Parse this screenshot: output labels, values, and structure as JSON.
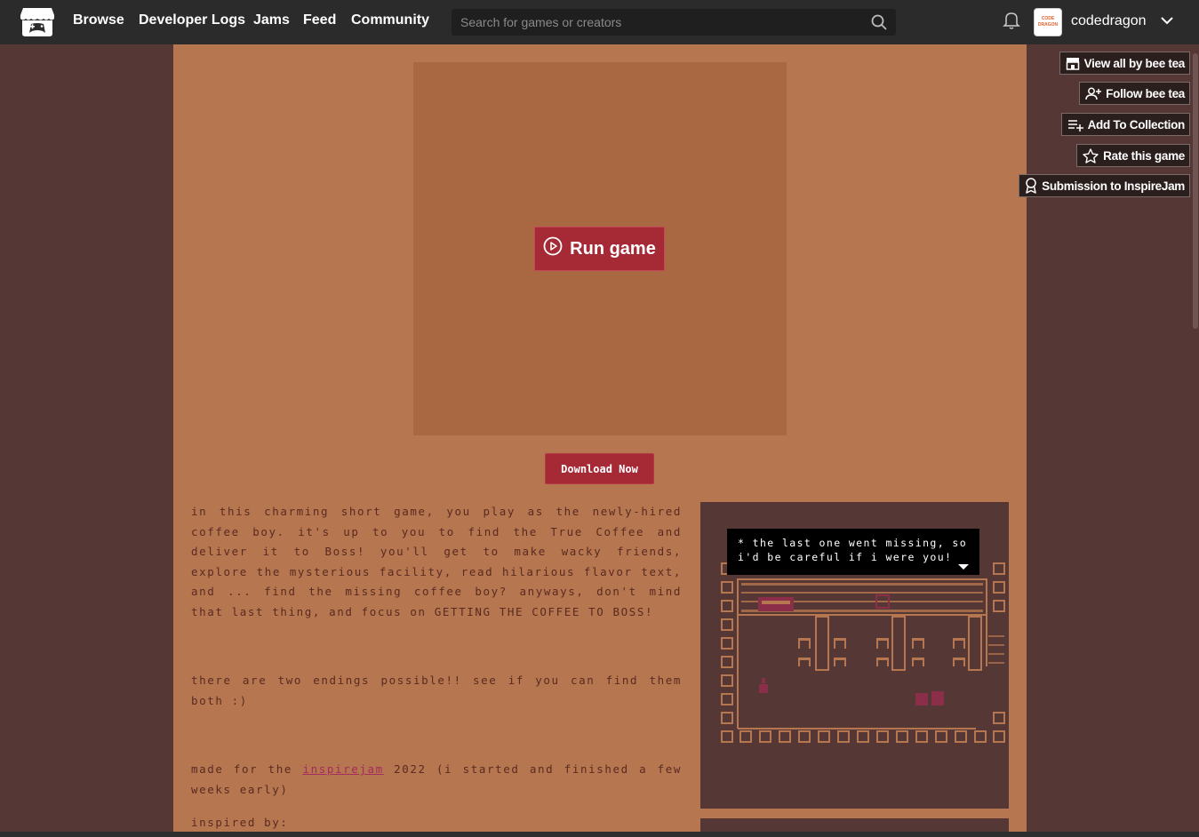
{
  "nav": {
    "links": [
      "Browse",
      "Developer Logs",
      "Jams",
      "Feed",
      "Community"
    ],
    "search_placeholder": "Search for games or creators",
    "username": "codedragon",
    "avatar_text": "CODE DRAGON"
  },
  "sidebar": {
    "buttons": [
      {
        "label": "View all by bee tea",
        "icon": "itch-store-icon"
      },
      {
        "label": "Follow bee tea",
        "icon": "follow-user-icon"
      },
      {
        "label": "Add To Collection",
        "icon": "add-collection-icon"
      },
      {
        "label": "Rate this game",
        "icon": "star-icon"
      },
      {
        "label": "Submission to InspireJam",
        "icon": "ribbon-icon"
      }
    ]
  },
  "game": {
    "run_label": "Run game",
    "download_label": "Download Now",
    "description": {
      "p1": "in this charming short game, you play as the newly-hired coffee boy. it's up to you to find the True Coffee and deliver it to Boss! you'll get to make wacky friends, explore the mysterious facility, read hilarious flavor text, and ... find the missing coffee boy? anyways, don't mind that last thing, and focus on GETTING THE COFFEE TO BOSS!",
      "p2": "there are two endings possible!! see if you can find them both :)",
      "p3_before": "made for the ",
      "p3_link": "inspirejam",
      "p3_after": " 2022 (i started and finished a few weeks early)",
      "p4": "inspired by:"
    },
    "screenshot_dialog": "* the last one went missing, so i'd be careful if i were you!"
  },
  "colors": {
    "page_bg": "#553735",
    "column_bg": "#b6764f",
    "embed_bg": "#a96841",
    "button_red": "#a52a36",
    "text_brown": "#5a2b22"
  }
}
